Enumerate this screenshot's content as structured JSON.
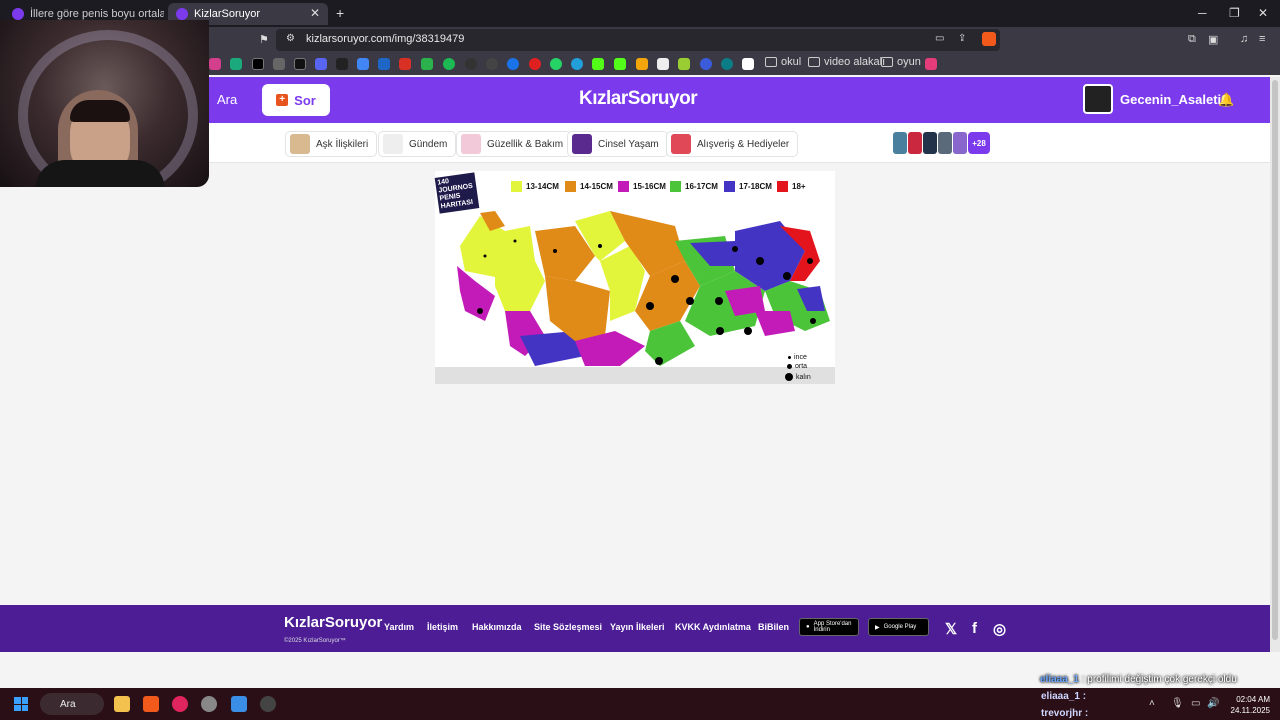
{
  "browser": {
    "tabs": [
      {
        "title": "İllere göre penis boyu ortalaması ne...",
        "active": false
      },
      {
        "title": "KizlarSoruyor",
        "active": true
      }
    ],
    "url": "kizlarsoruyor.com/img/38319479",
    "bookmark_folders": [
      "okul",
      "video alakalı",
      "oyun"
    ]
  },
  "site": {
    "search_label": "Ara",
    "ask_button": "Sor",
    "logo": "KızlarSoruyor",
    "username": "Gecenin_Asaleti",
    "categories": [
      "Aşk İlişkileri",
      "Gündem",
      "Güzellik & Bakım",
      "Cinsel Yaşam",
      "Alışveriş & Hediyeler"
    ],
    "more_count": "+28"
  },
  "map": {
    "badge": "140 JOURNOS PENIS HARITASI",
    "legend": [
      {
        "label": "13-14CM",
        "color": "#e2f53a"
      },
      {
        "label": "14-15CM",
        "color": "#e08a17"
      },
      {
        "label": "15-16CM",
        "color": "#c21bb8"
      },
      {
        "label": "16-17CM",
        "color": "#4cc43a"
      },
      {
        "label": "17-18CM",
        "color": "#4434c4"
      },
      {
        "label": "18+",
        "color": "#e3141b"
      }
    ],
    "dot_legend": [
      "ince",
      "orta",
      "kalın"
    ]
  },
  "footer": {
    "logo": "KızlarSoruyor",
    "copyright": "©2025 KızlarSoruyor™",
    "links": [
      "Yardım",
      "İletişim",
      "Hakkımızda",
      "Site Sözleşmesi",
      "Yayın İlkeleri",
      "KVKK Aydınlatma",
      "BiBilen"
    ],
    "appstore": "App Store'dan İndirin",
    "googleplay": "Google Play"
  },
  "overlay": {
    "chat_name": "eliaaa_1",
    "chat_text": ": profilimi değiştim çok gerekçi oldu",
    "chat_users": [
      "eliaaa_1 :",
      "trevorjhr :"
    ]
  },
  "taskbar": {
    "search": "Ara",
    "time": "02:04 AM",
    "date": "24.11.2025"
  }
}
